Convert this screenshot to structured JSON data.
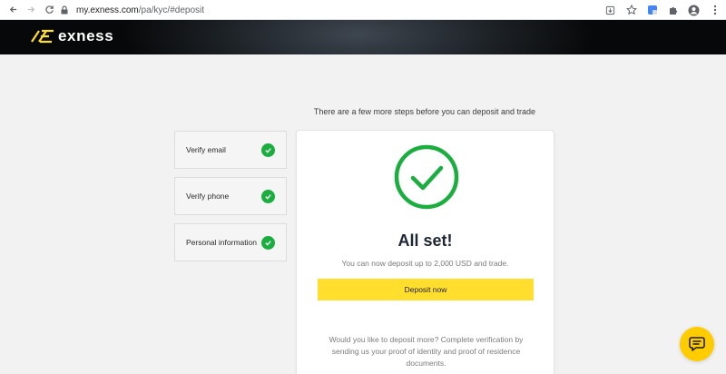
{
  "browser": {
    "url_host": "my.exness.com",
    "url_path": "/pa/kyc/#deposit"
  },
  "header": {
    "logo_text": "exness",
    "brand_color": "#ffde2e"
  },
  "main": {
    "steps_title": "There are a few more steps before you can deposit and trade",
    "steps": [
      {
        "label": "Verify email",
        "status": "complete"
      },
      {
        "label": "Verify phone",
        "status": "complete"
      },
      {
        "label": "Personal information",
        "status": "complete"
      }
    ],
    "card": {
      "title": "All set!",
      "subtitle": "You can now deposit up to 2,000 USD and trade.",
      "deposit_button": "Deposit now",
      "note": "Would you like to deposit more? Complete verification by sending us your proof of identity and proof of residence documents."
    }
  },
  "colors": {
    "check_green": "#1aae3f",
    "button_yellow": "#ffde2e",
    "chat_yellow": "#ffcc00"
  }
}
